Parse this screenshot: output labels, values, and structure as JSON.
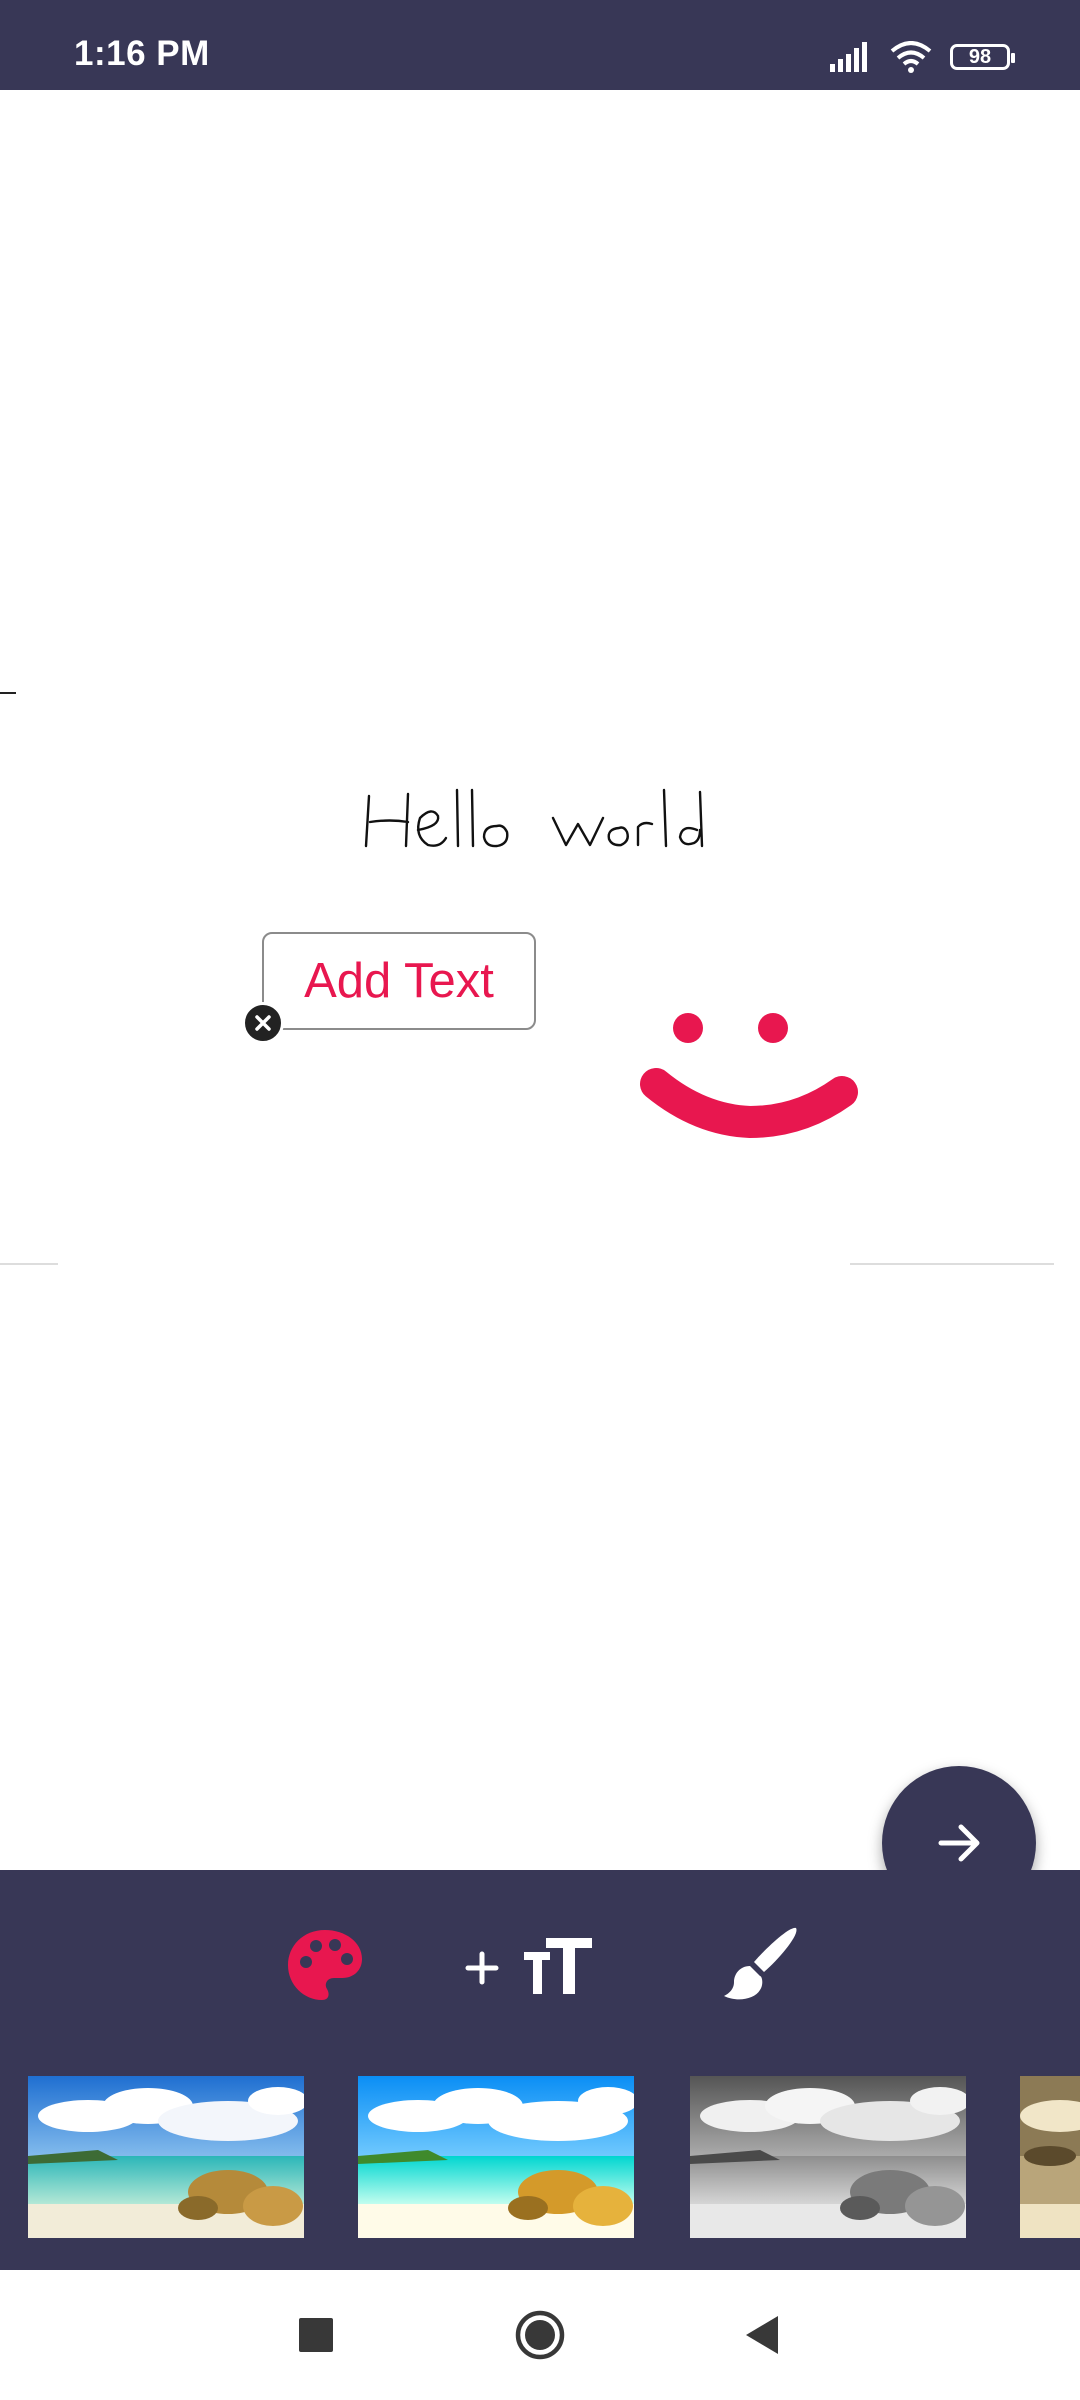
{
  "status_bar": {
    "time": "1:16 PM",
    "battery_level": "98",
    "icons": [
      "signal-icon",
      "wifi-icon",
      "battery-icon"
    ]
  },
  "canvas": {
    "handwritten_text": "Hello World",
    "text_sticker": {
      "label": "Add Text",
      "close_icon": "close-icon"
    },
    "drawing": "smiley-drawing",
    "next_button_icon": "arrow-right-icon"
  },
  "toolbar": {
    "tools": [
      "palette-icon",
      "add-text-icon",
      "brush-icon"
    ]
  },
  "filters": {
    "thumbnails": [
      "original",
      "vivid",
      "grayscale",
      "sepia"
    ]
  },
  "nav_bar": {
    "buttons": [
      "recents-button",
      "home-button",
      "back-button"
    ]
  },
  "colors": {
    "primary_dark": "#383756",
    "accent": "#e8174f",
    "canvas": "#ffffff"
  }
}
